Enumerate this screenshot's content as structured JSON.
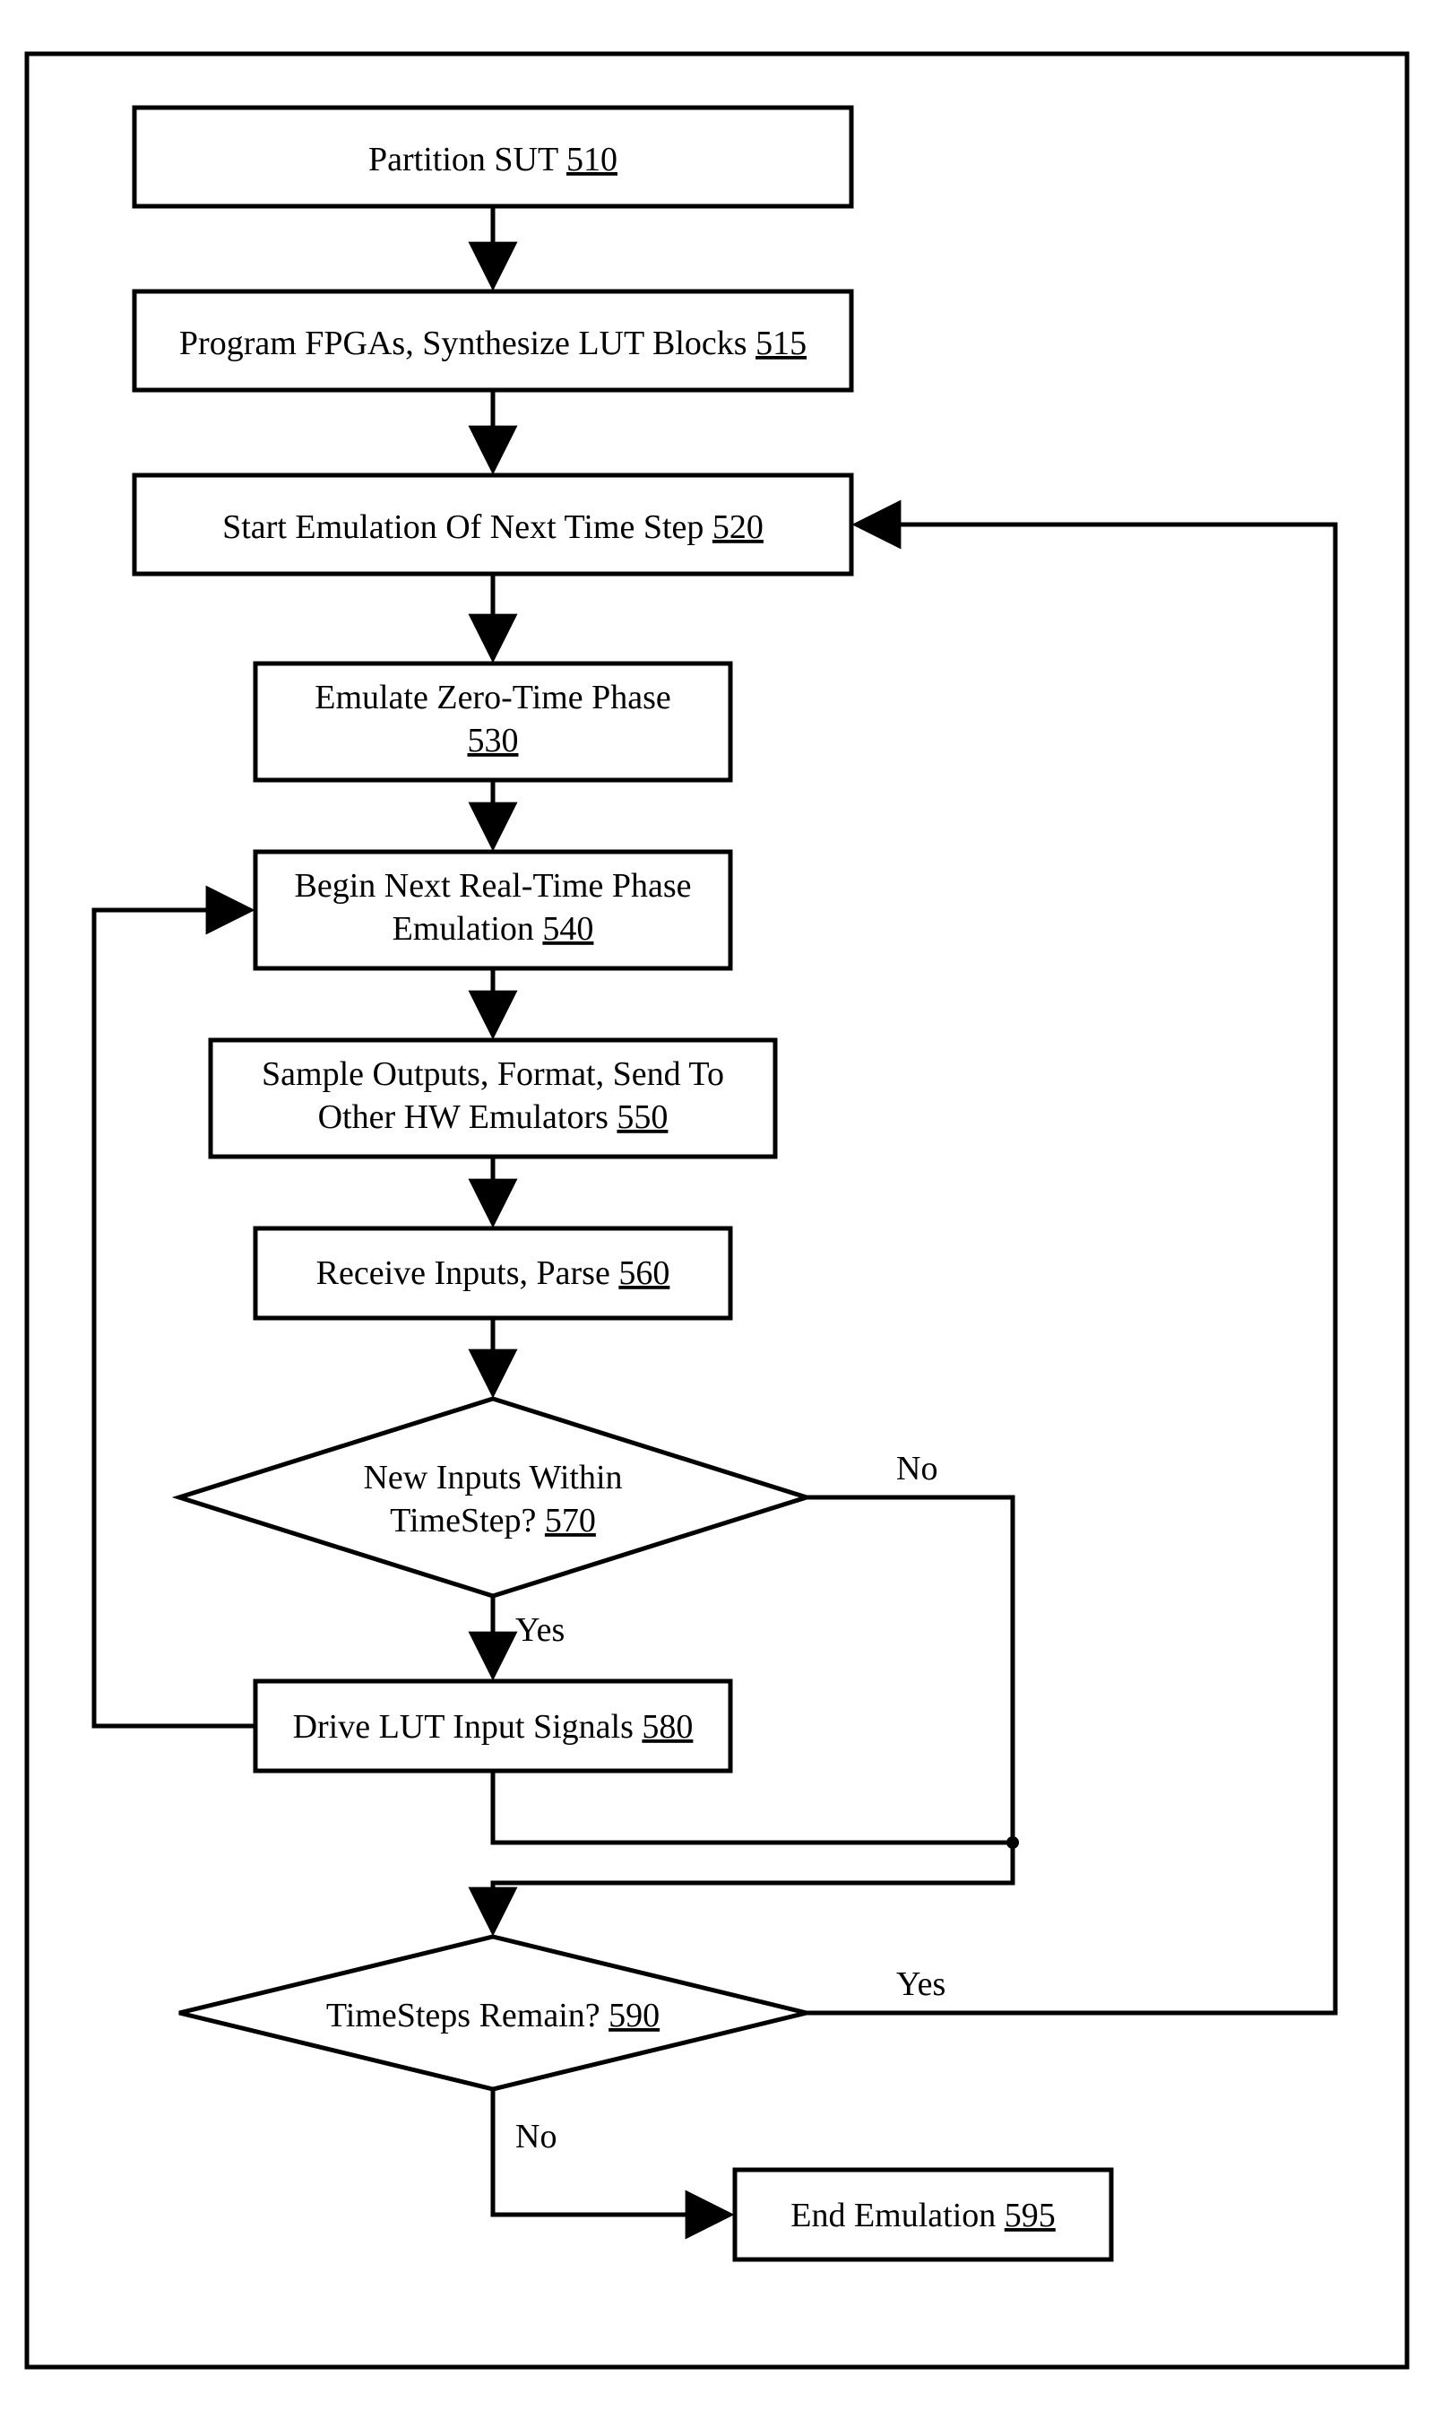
{
  "flow": {
    "box510": {
      "line1": "Partition SUT  ",
      "ref": "510"
    },
    "box515": {
      "line1": "Program FPGAs, Synthesize LUT Blocks  ",
      "ref": "515"
    },
    "box520": {
      "line1": "Start Emulation Of Next Time Step  ",
      "ref": "520"
    },
    "box530": {
      "line1": "Emulate Zero-Time Phase",
      "ref": "530"
    },
    "box540": {
      "line1": "Begin Next Real-Time Phase",
      "line2": "Emulation  ",
      "ref": "540"
    },
    "box550": {
      "line1": "Sample Outputs,  Format,  Send To",
      "line2": "Other HW Emulators  ",
      "ref": "550"
    },
    "box560": {
      "line1": "Receive Inputs,  Parse  ",
      "ref": "560"
    },
    "dec570": {
      "line1": "New Inputs Within",
      "line2": "TimeStep?  ",
      "ref": "570"
    },
    "box580": {
      "line1": "Drive LUT Input Signals  ",
      "ref": "580"
    },
    "dec590": {
      "line1": "TimeSteps Remain?  ",
      "ref": "590"
    },
    "box595": {
      "line1": "End Emulation  ",
      "ref": "595"
    },
    "labels": {
      "yes": "Yes",
      "no": "No"
    }
  }
}
